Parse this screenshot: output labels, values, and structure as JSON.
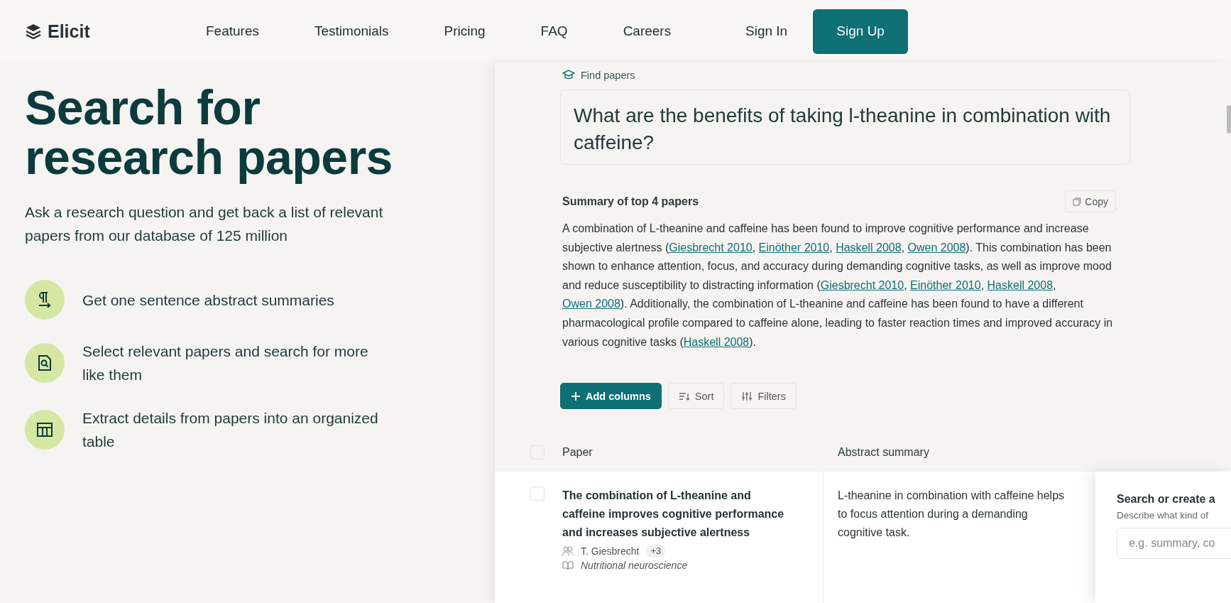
{
  "nav": {
    "logo": "Elicit",
    "links": [
      "Features",
      "Testimonials",
      "Pricing",
      "FAQ",
      "Careers"
    ],
    "sign_in": "Sign In",
    "sign_up": "Sign Up"
  },
  "hero": {
    "title": "Search for research papers",
    "subtitle": "Ask a research question and get back a list of relevant papers from our database of 125 million",
    "features": [
      {
        "kind": "paragraph",
        "text": "Get one sentence abstract summaries"
      },
      {
        "kind": "search",
        "text": "Select relevant papers and search for more like them"
      },
      {
        "kind": "table",
        "text": "Extract details from papers into an organized table"
      }
    ]
  },
  "app": {
    "mode": "Find papers",
    "question": "What are the benefits of taking l-theanine in combination with caffeine?",
    "summary": {
      "title": "Summary of top 4 papers",
      "copy": "Copy",
      "segments": [
        {
          "kind": "text",
          "text": "A combination of L-theanine and caffeine has been found to improve cognitive performance and increase subjective alertness ("
        },
        {
          "kind": "link",
          "text": "Giesbrecht 2010"
        },
        {
          "kind": "text",
          "text": ", "
        },
        {
          "kind": "link",
          "text": "Einöther 2010"
        },
        {
          "kind": "text",
          "text": ", "
        },
        {
          "kind": "link",
          "text": "Haskell 2008"
        },
        {
          "kind": "text",
          "text": ", "
        },
        {
          "kind": "link",
          "text": "Owen 2008"
        },
        {
          "kind": "text",
          "text": "). This combination has been shown to enhance attention, focus, and accuracy during demanding cognitive tasks, as well as improve mood and reduce susceptibility to distracting information ("
        },
        {
          "kind": "link",
          "text": "Giesbrecht 2010"
        },
        {
          "kind": "text",
          "text": ", "
        },
        {
          "kind": "link",
          "text": "Einöther 2010"
        },
        {
          "kind": "text",
          "text": ", "
        },
        {
          "kind": "link",
          "text": "Haskell 2008"
        },
        {
          "kind": "text",
          "text": ", "
        },
        {
          "kind": "link",
          "text": "Owen 2008"
        },
        {
          "kind": "text",
          "text": "). Additionally, the combination of L-theanine and caffeine has been found to have a different pharmacological profile compared to caffeine alone, leading to faster reaction times and improved accuracy in various cognitive tasks ("
        },
        {
          "kind": "link",
          "text": "Haskell 2008"
        },
        {
          "kind": "text",
          "text": ")."
        }
      ]
    },
    "toolbar": [
      {
        "kind": "add",
        "label": "Add columns"
      },
      {
        "kind": "sort",
        "label": "Sort"
      },
      {
        "kind": "filter",
        "label": "Filters"
      }
    ],
    "table": {
      "columns": [
        "Paper",
        "Abstract summary"
      ],
      "header_checked": false,
      "rows": [
        {
          "checked": false,
          "title": "The combination of L-theanine and caffeine improves cognitive performance and increases subjective alertness",
          "author": "T. Giesbrecht",
          "more_authors": "+3",
          "journal": "Nutritional neuroscience",
          "summary": "L-theanine in combination with caffeine helps to focus attention during a demanding cognitive task."
        }
      ]
    },
    "column_popup": {
      "title": "Search or create a",
      "hint": "Describe what kind of",
      "placeholder": "e.g. summary, co"
    }
  }
}
